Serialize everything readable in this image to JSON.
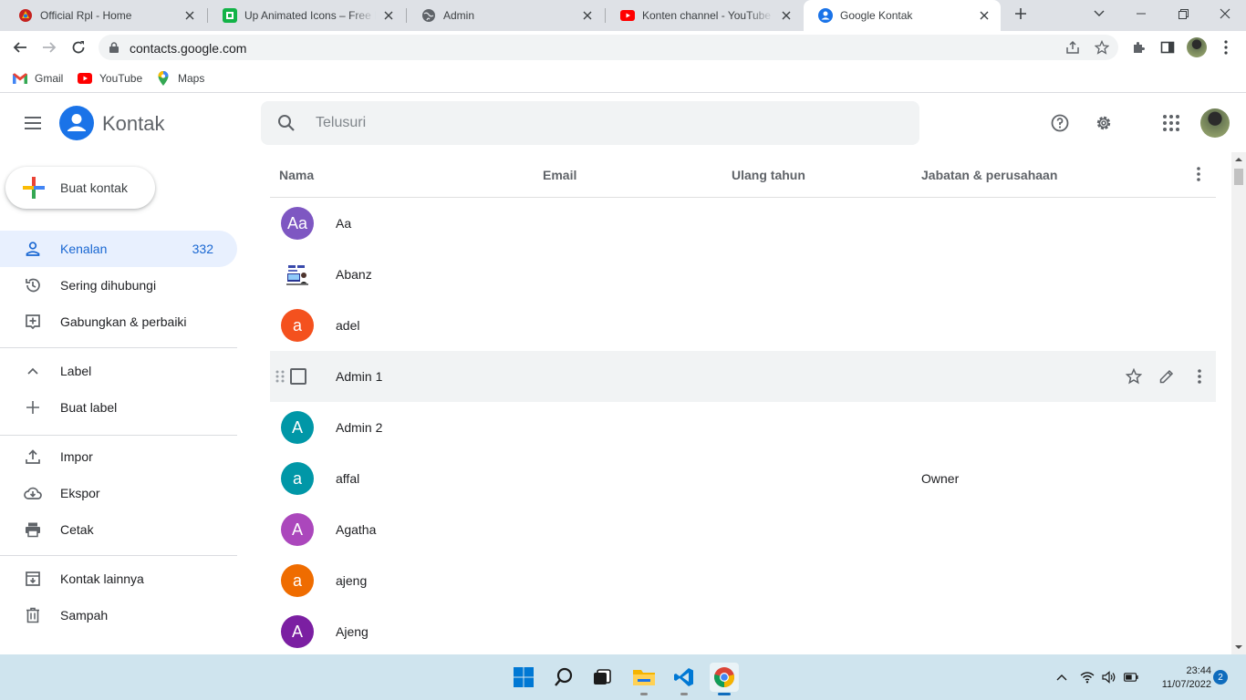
{
  "browser": {
    "tabs": [
      {
        "title": "Official Rpl - Home"
      },
      {
        "title": "Up Animated Icons – Free Do"
      },
      {
        "title": "Admin"
      },
      {
        "title": "Konten channel - YouTube St"
      },
      {
        "title": "Google Kontak"
      }
    ],
    "url": "contacts.google.com",
    "bookmarks": [
      {
        "label": "Gmail"
      },
      {
        "label": "YouTube"
      },
      {
        "label": "Maps"
      }
    ]
  },
  "app": {
    "name": "Kontak",
    "search_placeholder": "Telusuri",
    "create_button": "Buat kontak",
    "nav": {
      "contacts": {
        "label": "Kenalan",
        "count": "332"
      },
      "frequent": {
        "label": "Sering dihubungi"
      },
      "merge": {
        "label": "Gabungkan & perbaiki"
      },
      "labels": {
        "label": "Label"
      },
      "create_label": {
        "label": "Buat label"
      },
      "import": {
        "label": "Impor"
      },
      "export": {
        "label": "Ekspor"
      },
      "print": {
        "label": "Cetak"
      },
      "other": {
        "label": "Kontak lainnya"
      },
      "trash": {
        "label": "Sampah"
      }
    },
    "columns": {
      "name": "Nama",
      "email": "Email",
      "birthday": "Ulang tahun",
      "job": "Jabatan & perusahaan"
    },
    "contacts": [
      {
        "name": "Aa",
        "initial": "Aa",
        "color": "#7e57c2",
        "job": ""
      },
      {
        "name": "Abanz",
        "initial": "",
        "color": "#ffffff",
        "job": ""
      },
      {
        "name": "adel",
        "initial": "a",
        "color": "#f4511e",
        "job": ""
      },
      {
        "name": "Admin 1",
        "initial": "",
        "color": "#ffffff",
        "job": ""
      },
      {
        "name": "Admin 2",
        "initial": "A",
        "color": "#0097a7",
        "job": ""
      },
      {
        "name": "affal",
        "initial": "a",
        "color": "#0097a7",
        "job": "Owner"
      },
      {
        "name": "Agatha",
        "initial": "A",
        "color": "#ab47bc",
        "job": ""
      },
      {
        "name": "ajeng",
        "initial": "a",
        "color": "#ef6c00",
        "job": ""
      },
      {
        "name": "Ajeng",
        "initial": "A",
        "color": "#7b1fa2",
        "job": ""
      }
    ]
  },
  "taskbar": {
    "time": "23:44",
    "date": "11/07/2022",
    "notifications": "2"
  }
}
